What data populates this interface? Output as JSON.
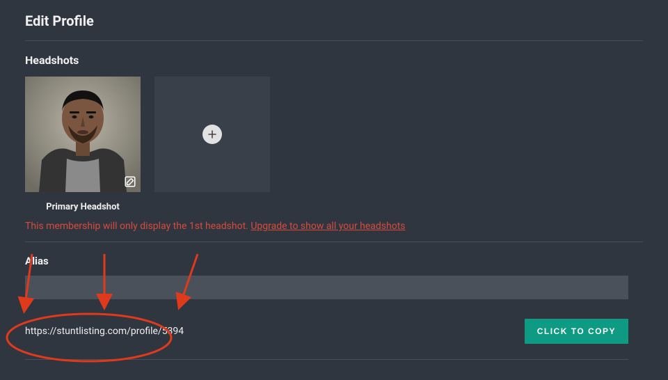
{
  "page": {
    "title": "Edit Profile"
  },
  "headshots": {
    "section_title": "Headshots",
    "primary_caption": "Primary Headshot",
    "warning_prefix": "This membership will only display the 1st headshot. ",
    "warning_link": "Upgrade to show all your headshots"
  },
  "alias": {
    "label": "Alias",
    "value": "",
    "profile_url": "https://stuntlisting.com/profile/5394",
    "copy_label": "CLICK TO COPY"
  },
  "icons": {
    "edit": "edit-icon",
    "add": "plus-icon"
  }
}
